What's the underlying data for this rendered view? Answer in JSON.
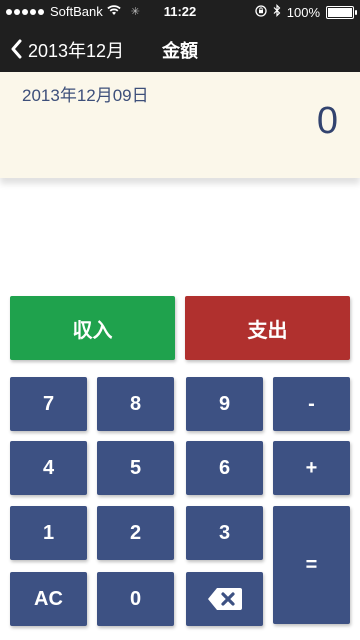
{
  "status_bar": {
    "carrier": "SoftBank",
    "time": "11:22",
    "battery": "100%",
    "battery_level": 1.0,
    "icons": [
      "signal-dots-icon",
      "wifi-icon",
      "activity-spinner-icon",
      "orientation-lock-icon",
      "bluetooth-icon",
      "battery-icon"
    ]
  },
  "nav": {
    "back_label": "2013年12月",
    "title": "金額"
  },
  "display": {
    "date": "2013年12月09日",
    "amount": "0"
  },
  "buttons": {
    "income": "収入",
    "expense": "支出",
    "seven": "7",
    "eight": "8",
    "nine": "9",
    "minus": "-",
    "four": "4",
    "five": "5",
    "six": "6",
    "plus": "+",
    "one": "1",
    "two": "2",
    "three": "3",
    "equals": "=",
    "ac": "AC",
    "zero": "0",
    "backspace_icon": "backspace-icon"
  },
  "colors": {
    "nav_bg": "#1f1f1f",
    "display_bg": "#fbf7ea",
    "key_blue": "#3d5183",
    "income_green": "#1fa24d",
    "expense_red": "#b0302e"
  }
}
